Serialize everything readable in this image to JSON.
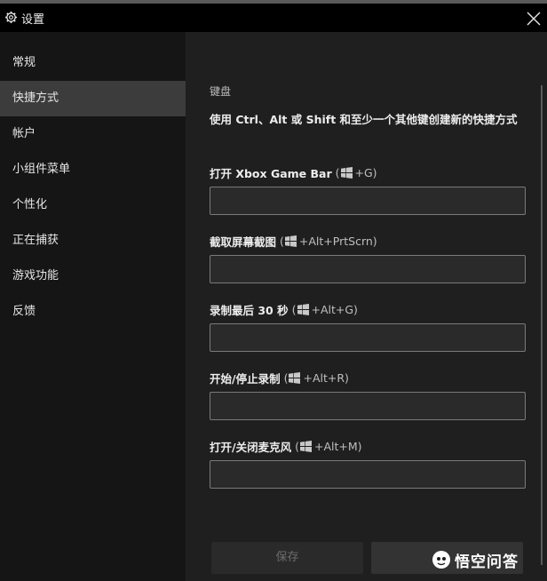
{
  "window": {
    "title": "设置",
    "icons": {
      "settings": "gear-icon",
      "close": "close-icon"
    }
  },
  "sidebar": {
    "items": [
      {
        "label": "常规"
      },
      {
        "label": "快捷方式",
        "active": true
      },
      {
        "label": "帐户"
      },
      {
        "label": "小组件菜单"
      },
      {
        "label": "个性化"
      },
      {
        "label": "正在捕获"
      },
      {
        "label": "游戏功能"
      },
      {
        "label": "反馈"
      }
    ]
  },
  "main": {
    "section_heading": "键盘",
    "description": "使用 Ctrl、Alt 或 Shift 和至少一个其他键创建新的快捷方式",
    "shortcuts": [
      {
        "label": "打开 Xbox Game Bar",
        "open_paren": "(",
        "combo": "+G)",
        "value": ""
      },
      {
        "label": "截取屏幕截图",
        "open_paren": "(",
        "combo": "+Alt+PrtScrn)",
        "value": ""
      },
      {
        "label": "录制最后 30 秒",
        "open_paren": "(",
        "combo": "+Alt+G)",
        "value": ""
      },
      {
        "label": "开始/停止录制",
        "open_paren": "(",
        "combo": "+Alt+R)",
        "value": ""
      },
      {
        "label": "打开/关闭麦克风",
        "open_paren": "(",
        "combo": "+Alt+M)",
        "value": ""
      }
    ],
    "buttons": {
      "save": "保存",
      "second": ""
    }
  },
  "watermark": {
    "text": "悟空问答"
  },
  "colors": {
    "titlebar": "#000000",
    "sidebar": "#151515",
    "active_item": "#3c3c3c",
    "main": "#1f1f1f",
    "input_border": "#7a7a7a"
  }
}
